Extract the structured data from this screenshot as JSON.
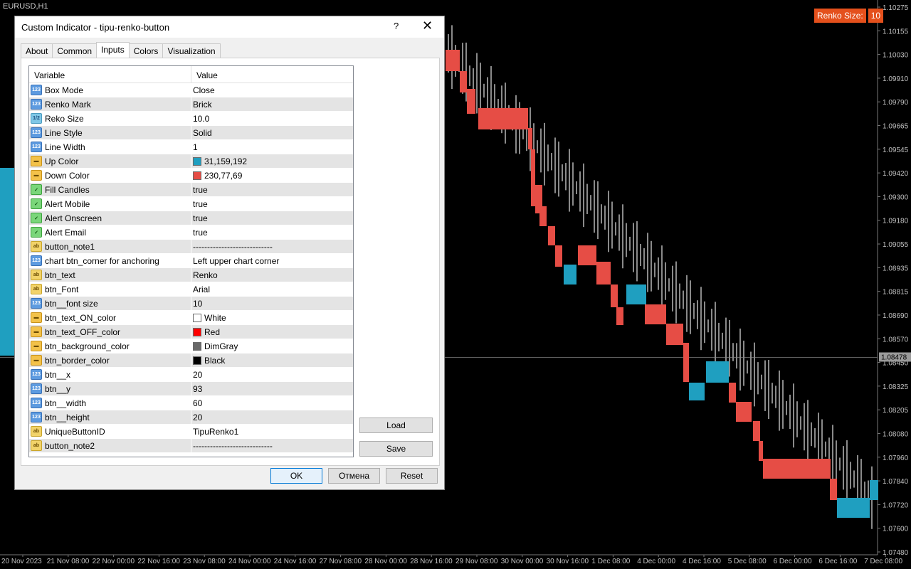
{
  "chart": {
    "symbol": "EURUSD,H1",
    "renko_label": "Renko Size:",
    "renko_value": "10",
    "price_ticks": [
      "1.10275",
      "1.10155",
      "1.10030",
      "1.09910",
      "1.09790",
      "1.09665",
      "1.09545",
      "1.09420",
      "1.09300",
      "1.09180",
      "1.09055",
      "1.08935",
      "1.08815",
      "1.08690",
      "1.08570",
      "1.08450",
      "1.08325",
      "1.08205",
      "1.08080",
      "1.07960",
      "1.07840",
      "1.07720",
      "1.07600",
      "1.07480"
    ],
    "current_price": "1.08478",
    "time_ticks": [
      "20 Nov 2023",
      "21 Nov 08:00",
      "22 Nov 00:00",
      "22 Nov 16:00",
      "23 Nov 08:00",
      "24 Nov 00:00",
      "24 Nov 16:00",
      "27 Nov 08:00",
      "28 Nov 00:00",
      "28 Nov 16:00",
      "29 Nov 08:00",
      "30 Nov 00:00",
      "30 Nov 16:00",
      "1 Dec 08:00",
      "4 Dec 00:00",
      "4 Dec 16:00",
      "5 Dec 08:00",
      "6 Dec 00:00",
      "6 Dec 16:00",
      "7 Dec 08:00"
    ],
    "colors": {
      "up": "#1f9fc0",
      "down": "#e64d45",
      "wick": "#8a8a8a",
      "grid": "#3a3a3a",
      "axis_text": "#c0c0c0"
    }
  },
  "dialog": {
    "title": "Custom Indicator - tipu-renko-button",
    "help_glyph": "?",
    "close_glyph": "✕",
    "tabs": [
      {
        "label": "About"
      },
      {
        "label": "Common"
      },
      {
        "label": "Inputs",
        "active": true
      },
      {
        "label": "Colors"
      },
      {
        "label": "Visualization"
      }
    ],
    "grid_header": {
      "variable": "Variable",
      "value": "Value"
    },
    "rows": [
      {
        "name": "Box Mode",
        "value": "Close",
        "icon": "int"
      },
      {
        "name": "Renko Mark",
        "value": "Brick",
        "icon": "int"
      },
      {
        "name": "Reko Size",
        "value": "10.0",
        "icon": "dbl"
      },
      {
        "name": "Line Style",
        "value": "Solid",
        "icon": "int"
      },
      {
        "name": "Line Width",
        "value": "1",
        "icon": "int"
      },
      {
        "name": "Up Color",
        "value": "31,159,192",
        "icon": "clr",
        "swatch": "#1f9fc0"
      },
      {
        "name": "Down Color",
        "value": "230,77,69",
        "icon": "clr",
        "swatch": "#e64d45"
      },
      {
        "name": "Fill Candles",
        "value": "true",
        "icon": "bool"
      },
      {
        "name": "Alert Mobile",
        "value": "true",
        "icon": "bool"
      },
      {
        "name": "Alert Onscreen",
        "value": "true",
        "icon": "bool"
      },
      {
        "name": "Alert Email",
        "value": "true",
        "icon": "bool"
      },
      {
        "name": "button_note1",
        "value": "----------------------------",
        "icon": "str"
      },
      {
        "name": "chart btn_corner for anchoring",
        "value": "Left upper chart corner",
        "icon": "int"
      },
      {
        "name": "btn_text",
        "value": "Renko",
        "icon": "str"
      },
      {
        "name": "btn_Font",
        "value": "Arial",
        "icon": "str"
      },
      {
        "name": "btn__font size",
        "value": "10",
        "icon": "int"
      },
      {
        "name": "btn_text_ON_color",
        "value": "White",
        "icon": "clr",
        "swatch": "#ffffff"
      },
      {
        "name": "btn_text_OFF_color",
        "value": "Red",
        "icon": "clr",
        "swatch": "#ff0000"
      },
      {
        "name": "btn_background_color",
        "value": "DimGray",
        "icon": "clr",
        "swatch": "#696969"
      },
      {
        "name": "btn_border_color",
        "value": "Black",
        "icon": "clr",
        "swatch": "#000000"
      },
      {
        "name": "btn__x",
        "value": "20",
        "icon": "int"
      },
      {
        "name": "btn__y",
        "value": "93",
        "icon": "int"
      },
      {
        "name": "btn__width",
        "value": "60",
        "icon": "int"
      },
      {
        "name": "btn__height",
        "value": "20",
        "icon": "int"
      },
      {
        "name": "UniqueButtonID",
        "value": "TipuRenko1",
        "icon": "str"
      },
      {
        "name": "button_note2",
        "value": "----------------------------",
        "icon": "str"
      }
    ],
    "icon_glyphs": {
      "int": "123",
      "dbl": "1/2",
      "bool": "✓",
      "str": "ab",
      "clr": "▬"
    },
    "buttons": {
      "load": "Load",
      "save": "Save",
      "ok": "OK",
      "cancel": "Отмена",
      "reset": "Reset"
    }
  }
}
